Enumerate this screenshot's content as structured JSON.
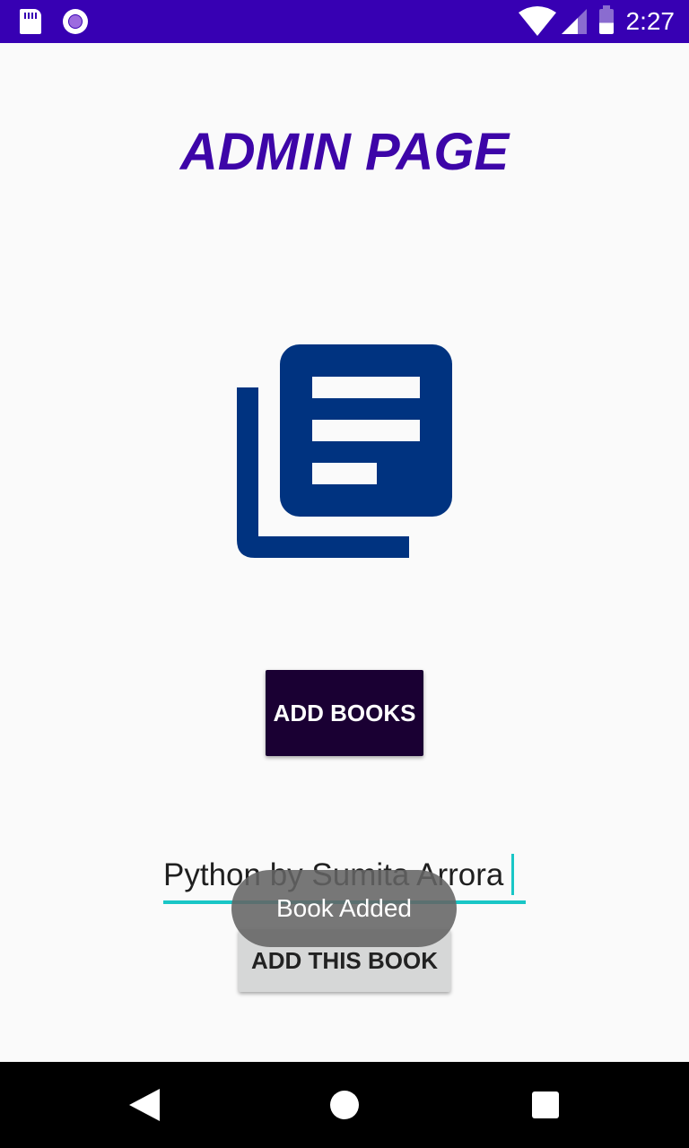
{
  "status_bar": {
    "time": "2:27",
    "background": "#3700b3",
    "icons": [
      "sd-card-icon",
      "radio-icon",
      "wifi-icon",
      "signal-icon",
      "battery-icon"
    ]
  },
  "page": {
    "title": "ADMIN PAGE",
    "title_color": "#3d05a8",
    "logo_icon": "library-books-icon",
    "logo_color": "#003380"
  },
  "buttons": {
    "add_books": "ADD BOOKS",
    "add_this_book": "ADD THIS BOOK"
  },
  "book_input": {
    "value": "Python by Sumita Arrora"
  },
  "toast": {
    "message": "Book Added"
  },
  "nav_bar": {
    "icons": [
      "back-icon",
      "home-icon",
      "recents-icon"
    ]
  }
}
